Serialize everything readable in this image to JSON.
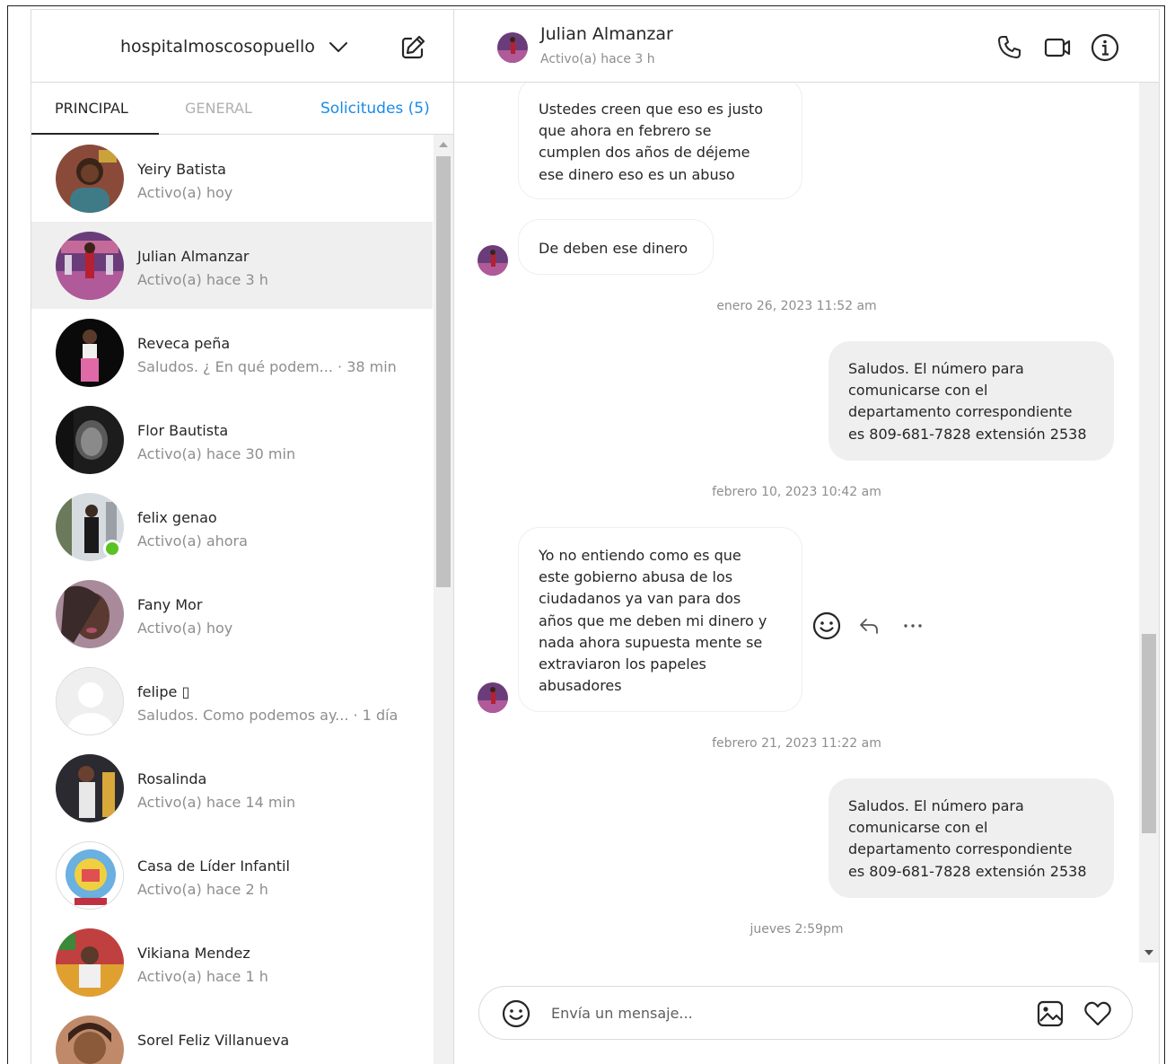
{
  "account": {
    "username": "hospitalmoscosopuello",
    "chevron_icon": "chevron-down-icon",
    "compose_icon": "new-message-icon"
  },
  "tabs": {
    "principal": "PRINCIPAL",
    "general": "GENERAL",
    "requests": "Solicitudes (5)"
  },
  "conversations": [
    {
      "name": "Yeiry Batista",
      "sub": "Activo(a) hoy",
      "active": false
    },
    {
      "name": "Julian Almanzar",
      "sub": "Activo(a) hace 3 h",
      "active": true
    },
    {
      "name": "Reveca peña",
      "sub": "Saludos. ¿ En qué podem...  · 38 min",
      "active": false
    },
    {
      "name": "Flor Bautista",
      "sub": "Activo(a) hace 30 min",
      "active": false
    },
    {
      "name": "felix genao",
      "sub": "Activo(a) ahora",
      "active": false,
      "online": true
    },
    {
      "name": "Fany Mor",
      "sub": "Activo(a) hoy",
      "active": false
    },
    {
      "name": "felipe ▯",
      "sub": "Saludos. Como podemos ay... · 1 día",
      "active": false
    },
    {
      "name": "Rosalinda",
      "sub": "Activo(a) hace 14 min",
      "active": false
    },
    {
      "name": "Casa de Líder Infantil",
      "sub": "Activo(a) hace 2 h",
      "active": false
    },
    {
      "name": "Vikiana Mendez",
      "sub": "Activo(a) hace 1 h",
      "active": false
    },
    {
      "name": "Sorel Feliz Villanueva",
      "sub": "",
      "active": false
    }
  ],
  "chat": {
    "name": "Julian Almanzar",
    "status": "Activo(a) hace 3 h",
    "icons": [
      "phone-icon",
      "video-call-icon",
      "info-icon"
    ]
  },
  "messages": {
    "m1": [
      "Ustedes creen que eso es justo",
      "que ahora en febrero se",
      "cumplen dos años de déjeme",
      "ese dinero eso es un abuso"
    ],
    "m2": [
      "De deben ese dinero"
    ],
    "ts1": "enero 26, 2023 11:52 am",
    "m3": [
      "Saludos. El número para",
      "comunicarse con el",
      "departamento correspondiente",
      "es 809-681-7828 extensión 2538"
    ],
    "ts2": "febrero 10, 2023 10:42 am",
    "m4": [
      "Yo no entiendo como es que",
      "este gobierno abusa de los",
      "ciudadanos ya van para dos",
      "años que me deben mi dinero y",
      "nada ahora supuesta mente se",
      "extraviaron los papeles",
      "abusadores"
    ],
    "ts3": "febrero 21, 2023 11:22 am",
    "m5": [
      "Saludos. El número para",
      "comunicarse con el",
      "departamento correspondiente",
      "es 809-681-7828 extensión 2538"
    ],
    "ts4": "jueves 2:59pm"
  },
  "composer": {
    "placeholder": "Envía un mensaje..."
  }
}
